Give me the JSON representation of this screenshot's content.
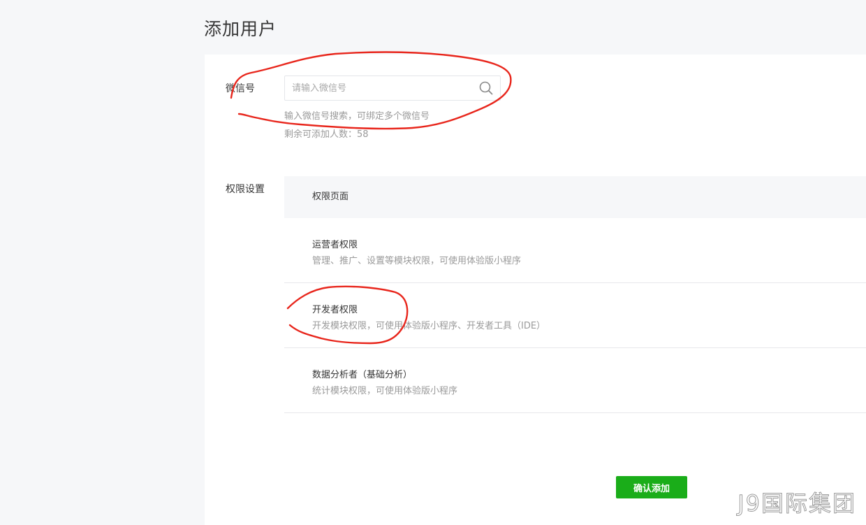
{
  "page": {
    "title": "添加用户"
  },
  "wechat": {
    "label": "微信号",
    "placeholder": "请输入微信号",
    "value": "",
    "hint": "输入微信号搜索，可绑定多个微信号",
    "remaining": "剩余可添加人数：58"
  },
  "permissions": {
    "label": "权限设置",
    "header": "权限页面",
    "items": [
      {
        "title": "运营者权限",
        "desc": "管理、推广、设置等模块权限，可使用体验版小程序"
      },
      {
        "title": "开发者权限",
        "desc": "开发模块权限，可使用体验版小程序、开发者工具（IDE）"
      },
      {
        "title": "数据分析者（基础分析）",
        "desc": "统计模块权限，可使用体验版小程序"
      }
    ]
  },
  "actions": {
    "confirm_label": "确认添加"
  },
  "watermark": {
    "text": "J9国际集团"
  },
  "colors": {
    "accent": "#1aad19",
    "annotation": "#e8261c"
  },
  "icons": {
    "search": "search-icon"
  }
}
